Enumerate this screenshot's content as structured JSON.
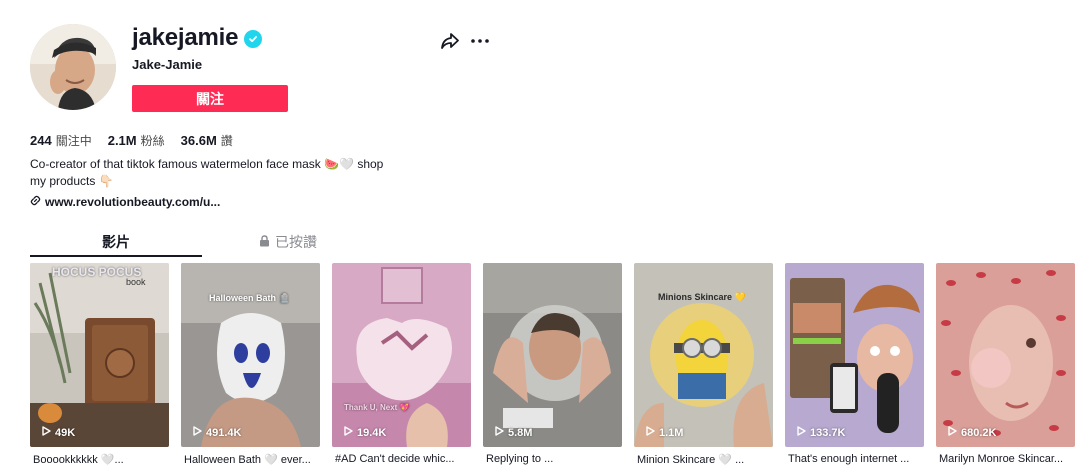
{
  "profile": {
    "username": "jakejamie",
    "nickname": "Jake-Jamie",
    "follow_label": "關注",
    "bio": "Co-creator of that tiktok famous watermelon face mask 🍉🤍 shop my products 👇🏻",
    "link": "www.revolutionbeauty.com/u...",
    "verified_icon": "verified-check-icon",
    "colors": {
      "follow": "#fe2c55",
      "verified": "#20d5ec"
    }
  },
  "stats": [
    {
      "value": "244",
      "label": "關注中"
    },
    {
      "value": "2.1M",
      "label": "粉絲"
    },
    {
      "value": "36.6M",
      "label": "讚"
    }
  ],
  "tabs": [
    {
      "label": "影片",
      "active": true
    },
    {
      "label": "已按讚",
      "icon": "lock-icon"
    }
  ],
  "videos": [
    {
      "views": "49K",
      "caption": "Booookkkkkk 🤍...",
      "overlay": [
        "HOCUS POCUS",
        "book"
      ]
    },
    {
      "views": "491.4K",
      "caption": "Halloween Bath 🤍 ever...",
      "overlay": [
        "Halloween Bath 🪦"
      ]
    },
    {
      "views": "19.4K",
      "caption": "#AD Can't decide whic...",
      "overlay": [
        "Thank U, Next 💖"
      ]
    },
    {
      "views": "5.8M",
      "caption": "Replying to ...",
      "overlay": []
    },
    {
      "views": "1.1M",
      "caption": "Minion Skincare 🤍 ...",
      "overlay": [
        "Minions Skincare 💛"
      ]
    },
    {
      "views": "133.7K",
      "caption": "That's enough internet ...",
      "overlay": []
    },
    {
      "views": "680.2K",
      "caption": "Marilyn Monroe Skincar...",
      "overlay": []
    }
  ]
}
